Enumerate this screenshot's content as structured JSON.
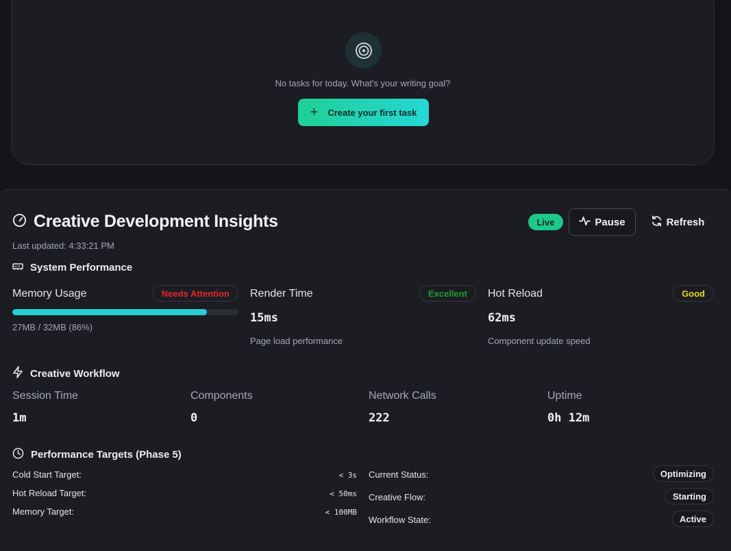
{
  "tasks": {
    "empty_text": "No tasks for today. What's your writing goal?",
    "create_button": "Create your first task",
    "icon": "target-icon"
  },
  "insights": {
    "title": "Creative Development Insights",
    "last_updated": "Last updated: 4:33:21 PM",
    "live_badge": "Live",
    "pause_label": "Pause",
    "refresh_label": "Refresh",
    "accent_color": "#1ec98a"
  },
  "system_performance": {
    "title": "System Performance",
    "memory": {
      "label": "Memory Usage",
      "status": "Needs Attention",
      "status_color": "#e0282d",
      "usage_text": "27MB / 32MB (86%)",
      "fraction": 0.86
    },
    "render": {
      "label": "Render Time",
      "status": "Excellent",
      "status_color": "#1f9a35",
      "value": "15ms",
      "sub": "Page load performance"
    },
    "hot_reload": {
      "label": "Hot Reload",
      "status": "Good",
      "status_color": "#e6d81a",
      "value": "62ms",
      "sub": "Component update speed"
    }
  },
  "workflow": {
    "title": "Creative Workflow",
    "items": [
      {
        "label": "Session Time",
        "value": "1m"
      },
      {
        "label": "Components",
        "value": "0"
      },
      {
        "label": "Network Calls",
        "value": "222"
      },
      {
        "label": "Uptime",
        "value": "0h 12m"
      }
    ]
  },
  "targets": {
    "title": "Performance Targets (Phase 5)",
    "left": [
      {
        "label": "Cold Start Target:",
        "value": "< 3s"
      },
      {
        "label": "Hot Reload Target:",
        "value": "< 50ms"
      },
      {
        "label": "Memory Target:",
        "value": "< 100MB"
      }
    ],
    "right": [
      {
        "label": "Current Status:",
        "value": "Optimizing"
      },
      {
        "label": "Creative Flow:",
        "value": "Starting"
      },
      {
        "label": "Workflow State:",
        "value": "Active"
      }
    ]
  }
}
